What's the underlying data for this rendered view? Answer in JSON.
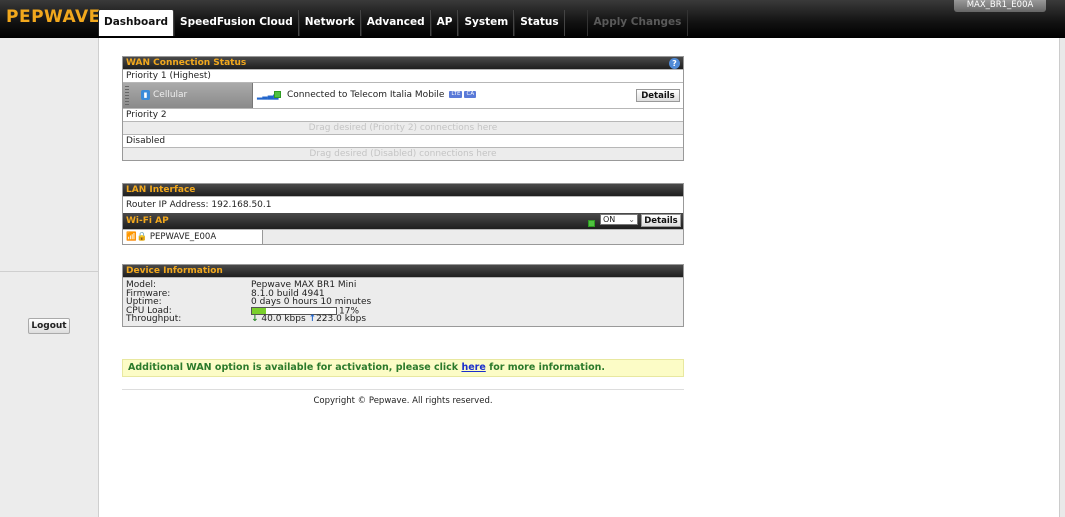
{
  "header": {
    "logo": "PEPWAVE",
    "device_name": "MAX_BR1_E00A",
    "nav": [
      "Dashboard",
      "SpeedFusion Cloud",
      "Network",
      "Advanced",
      "AP",
      "System",
      "Status"
    ],
    "apply_changes": "Apply Changes"
  },
  "sidebar": {
    "logout": "Logout"
  },
  "wan": {
    "title": "WAN Connection Status",
    "priority1": "Priority 1 (Highest)",
    "cellular_label": "Cellular",
    "connection_text": "Connected to Telecom Italia Mobile",
    "badge_lte": "LTE",
    "badge_ca": "CA",
    "details": "Details",
    "priority2": "Priority 2",
    "priority2_placeholder": "Drag desired (Priority 2) connections here",
    "disabled": "Disabled",
    "disabled_placeholder": "Drag desired (Disabled) connections here"
  },
  "lan": {
    "title": "LAN Interface",
    "router_ip": "Router IP Address: 192.168.50.1"
  },
  "wifi": {
    "title": "Wi-Fi AP",
    "toggle_value": "ON",
    "details": "Details",
    "ssid": "PEPWAVE_E00A"
  },
  "device": {
    "title": "Device Information",
    "rows": [
      {
        "label": "Model:",
        "value": "Pepwave MAX BR1 Mini"
      },
      {
        "label": "Firmware:",
        "value": "8.1.0 build 4941"
      },
      {
        "label": "Uptime:",
        "value": "0 days 0 hours 10 minutes"
      },
      {
        "label": "CPU Load:",
        "value": "17%"
      },
      {
        "label": "Throughput:",
        "value": ""
      }
    ],
    "cpu_load_fraction": 0.17,
    "throughput_down": "40.0 kbps",
    "throughput_up": "223.0 kbps"
  },
  "notice": {
    "before": "Additional WAN option is available for activation, please click ",
    "link": "here",
    "after": " for more information."
  },
  "footer": {
    "copyright": "Copyright © Pepwave. All rights reserved."
  },
  "colors": {
    "accent": "#f2a81d",
    "status_green": "#4fc23f"
  }
}
